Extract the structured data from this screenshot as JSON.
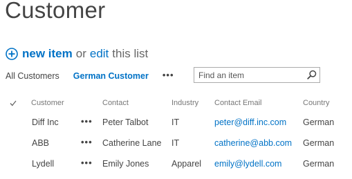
{
  "page": {
    "title": "Customer"
  },
  "command_bar": {
    "new_item_label": "new item",
    "or_text": "or",
    "edit_label": "edit",
    "list_text": "this list",
    "add_icon": "plus-circle-icon",
    "accent": "#0072c6"
  },
  "views": {
    "items": [
      {
        "label": "All Customers",
        "selected": false
      },
      {
        "label": "German Customer",
        "selected": true
      }
    ],
    "more_label": "•••"
  },
  "search": {
    "placeholder": "Find an item",
    "value": "",
    "icon": "search-icon"
  },
  "table": {
    "columns": [
      "Customer",
      "Contact",
      "Industry",
      "Contact Email",
      "Country"
    ],
    "rows": [
      {
        "customer": "Diff Inc",
        "contact": "Peter Talbot",
        "industry": "IT",
        "email": "peter@diff.inc.com",
        "country": "German"
      },
      {
        "customer": "ABB",
        "contact": "Catherine Lane",
        "industry": "IT",
        "email": "catherine@abb.com",
        "country": "German"
      },
      {
        "customer": "Lydell",
        "contact": "Emily Jones",
        "industry": "Apparel",
        "email": "emily@lydell.com",
        "country": "German"
      }
    ],
    "row_menu_label": "•••"
  }
}
